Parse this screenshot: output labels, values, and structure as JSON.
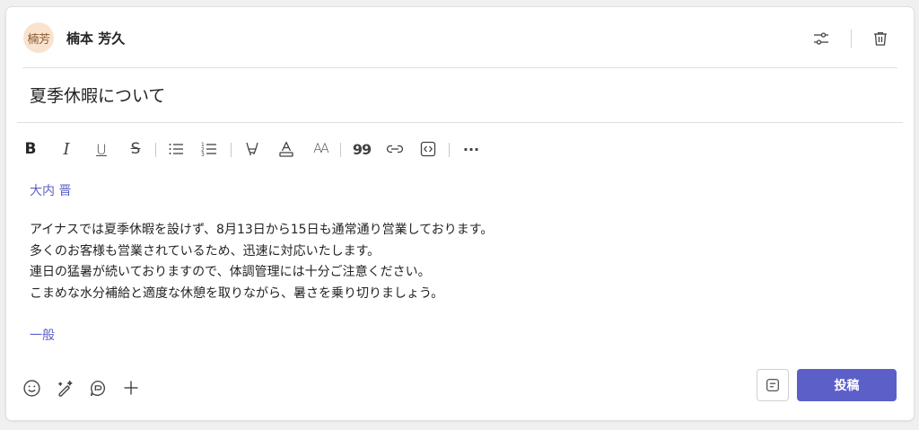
{
  "header": {
    "avatar_initials": "楠芳",
    "author_name": "楠本 芳久"
  },
  "subject": "夏季休暇について",
  "toolbar": {
    "items": [
      "bold-icon",
      "italic-icon",
      "underline-icon",
      "strikethrough-icon",
      "bulleted-list-icon",
      "numbered-list-icon",
      "highlight-icon",
      "font-color-icon",
      "font-size-icon",
      "quote-icon",
      "link-icon",
      "code-snippet-icon",
      "more-options-icon"
    ],
    "bold_glyph": "B",
    "italic_glyph": "I",
    "underline_glyph": "U",
    "strike_glyph": "S",
    "font_size_glyph": "AA",
    "quote_glyph": "99",
    "more_glyph": "···"
  },
  "message": {
    "mention": "大内 晋",
    "lines": [
      "アイナスでは夏季休暇を設けず、8月13日から15日も通常通り営業しております。",
      "多くのお客様も営業されているため、迅速に対応いたします。",
      "連日の猛暑が続いておりますので、体調管理には十分ご注意ください。",
      "こまめな水分補給と適度な休憩を取りながら、暑さを乗り切りましょう。"
    ],
    "channel_tag": "一般"
  },
  "footer": {
    "post_label": "投稿"
  },
  "colors": {
    "accent": "#5b5fc7",
    "avatar_bg": "#f9e3cf",
    "text": "#242424"
  }
}
